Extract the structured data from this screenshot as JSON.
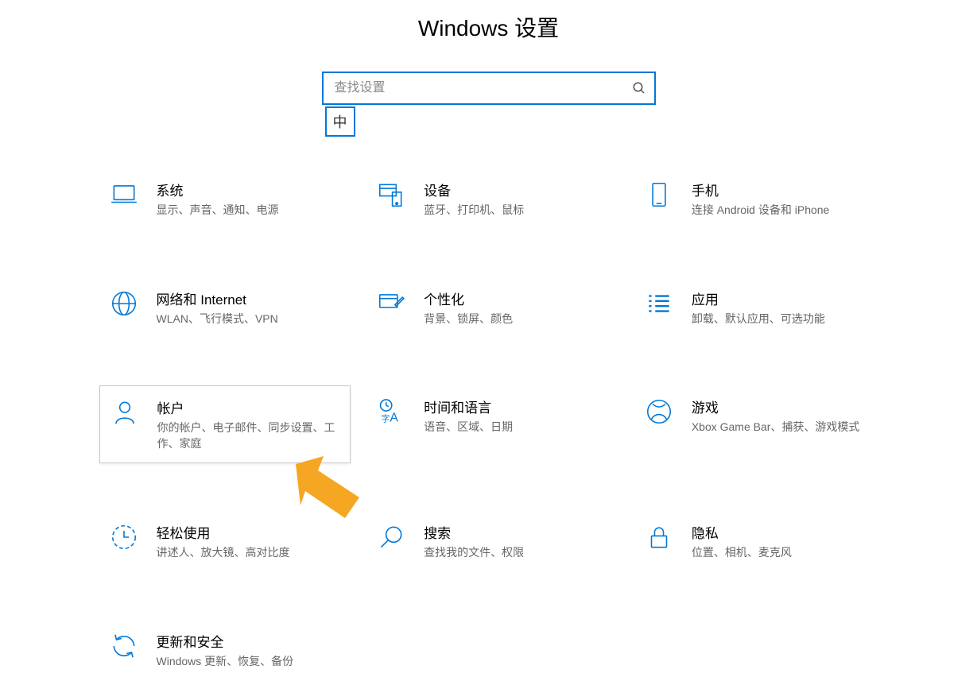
{
  "page_title": "Windows 设置",
  "search": {
    "placeholder": "查找设置"
  },
  "ime": {
    "indicator": "中"
  },
  "tiles": {
    "system": {
      "title": "系统",
      "desc": "显示、声音、通知、电源"
    },
    "devices": {
      "title": "设备",
      "desc": "蓝牙、打印机、鼠标"
    },
    "phone": {
      "title": "手机",
      "desc": "连接 Android 设备和 iPhone"
    },
    "network": {
      "title": "网络和 Internet",
      "desc": "WLAN、飞行模式、VPN"
    },
    "personalize": {
      "title": "个性化",
      "desc": "背景、锁屏、颜色"
    },
    "apps": {
      "title": "应用",
      "desc": "卸载、默认应用、可选功能"
    },
    "accounts": {
      "title": "帐户",
      "desc": "你的帐户、电子邮件、同步设置、工作、家庭"
    },
    "time": {
      "title": "时间和语言",
      "desc": "语音、区域、日期"
    },
    "gaming": {
      "title": "游戏",
      "desc": "Xbox Game Bar、捕获、游戏模式"
    },
    "ease": {
      "title": "轻松使用",
      "desc": "讲述人、放大镜、高对比度"
    },
    "searchcat": {
      "title": "搜索",
      "desc": "查找我的文件、权限"
    },
    "privacy": {
      "title": "隐私",
      "desc": "位置、相机、麦克风"
    },
    "update": {
      "title": "更新和安全",
      "desc": "Windows 更新、恢复、备份"
    }
  },
  "colors": {
    "accent": "#0078d7",
    "arrow": "#f5a623"
  }
}
